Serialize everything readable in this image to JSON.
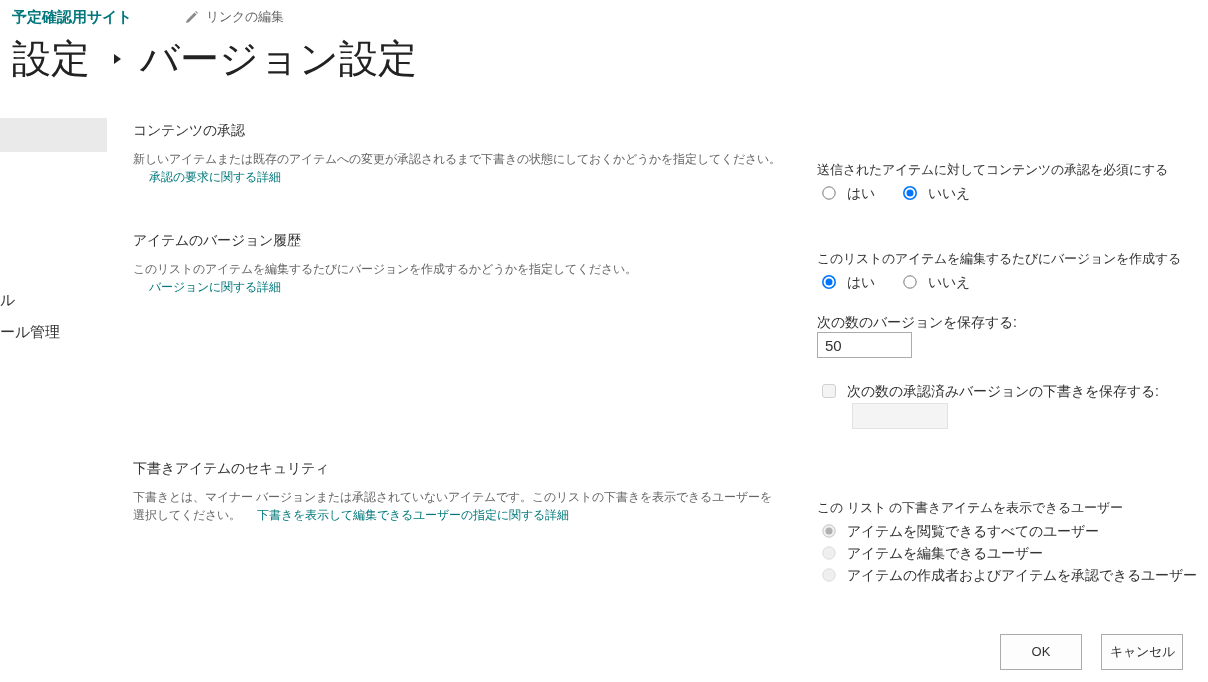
{
  "header": {
    "site_title": "予定確認用サイト",
    "edit_links": "リンクの編集"
  },
  "breadcrumb": {
    "parent": "設定",
    "current": "バージョン設定"
  },
  "sidebar": {
    "items": [
      {
        "selected": true
      },
      {
        "label": "ル",
        "selected": false
      },
      {
        "label": "ール管理",
        "selected": false
      }
    ]
  },
  "sections": [
    {
      "title": "コンテンツの承認",
      "description": "新しいアイテムまたは既存のアイテムへの変更が承認されるまで下書きの状態にしておくかどうかを指定してください。",
      "link": "承認の要求に関する詳細",
      "controls": [
        {
          "kind": "radio_row",
          "label": "送信されたアイテムに対してコンテンツの承認を必須にする",
          "disabled": false,
          "options": [
            {
              "label": "はい",
              "selected": false
            },
            {
              "label": "いいえ",
              "selected": true
            }
          ]
        }
      ]
    },
    {
      "title": "アイテムのバージョン履歴",
      "description": "このリストのアイテムを編集するたびにバージョンを作成するかどうかを指定してください。",
      "link": "バージョンに関する詳細",
      "controls": [
        {
          "kind": "radio_row",
          "label": "このリストのアイテムを編集するたびにバージョンを作成する",
          "disabled": false,
          "options": [
            {
              "label": "はい",
              "selected": true
            },
            {
              "label": "いいえ",
              "selected": false
            }
          ]
        },
        {
          "kind": "number_field",
          "label": "次の数のバージョンを保存する:",
          "value": "50"
        },
        {
          "kind": "checkbox",
          "label": "次の数の承認済みバージョンの下書きを保存する:",
          "checked": false,
          "disabled": true
        }
      ]
    },
    {
      "title": "下書きアイテムのセキュリティ",
      "description": "下書きとは、マイナー バージョンまたは承認されていないアイテムです。このリストの下書きを表示できるユーザーを選択してください。",
      "link": "下書きを表示して編集できるユーザーの指定に関する詳細",
      "controls": [
        {
          "kind": "radio_list",
          "label": "この リスト の下書きアイテムを表示できるユーザー",
          "disabled": true,
          "options": [
            {
              "label": "アイテムを閲覧できるすべてのユーザー",
              "selected": true
            },
            {
              "label": "アイテムを編集できるユーザー",
              "selected": false
            },
            {
              "label": "アイテムの作成者およびアイテムを承認できるユーザー",
              "selected": false
            }
          ]
        }
      ]
    }
  ],
  "buttons": [
    {
      "label": "OK"
    },
    {
      "label": "キャンセル"
    }
  ]
}
